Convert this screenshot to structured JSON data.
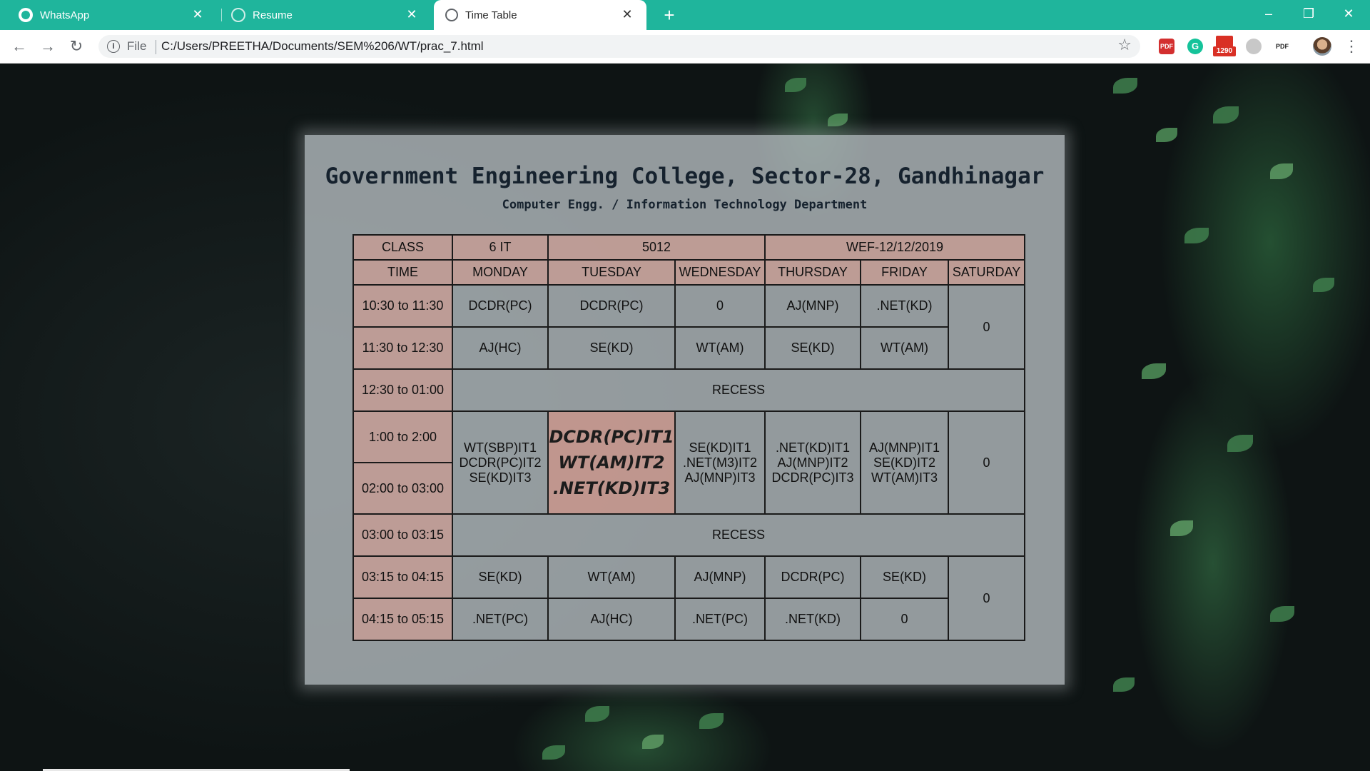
{
  "browser": {
    "tabs": [
      {
        "title": "WhatsApp",
        "icon": "whatsapp-icon"
      },
      {
        "title": "Resume",
        "icon": "globe-icon"
      },
      {
        "title": "Time Table",
        "icon": "globe-icon",
        "active": true
      }
    ],
    "address": {
      "scheme_label": "File",
      "url": "C:/Users/PREETHA/Documents/SEM%206/WT/prac_7.html"
    },
    "extensions": {
      "gmail_badge": "1290",
      "pdf_label": "PDF"
    }
  },
  "page": {
    "college": "Government Engineering College, Sector-28, Gandhinagar",
    "department": "Computer Engg. / Information Technology Department",
    "header_row": {
      "class_label": "CLASS",
      "class_value": "6 IT",
      "room": "5012",
      "wef": "WEF-12/12/2019"
    },
    "days_row": {
      "time_label": "TIME",
      "days": [
        "MONDAY",
        "TUESDAY",
        "WEDNESDAY",
        "THURSDAY",
        "FRIDAY",
        "SATURDAY"
      ]
    },
    "rows": {
      "r1": {
        "time": "10:30 to 11:30",
        "cells": [
          "DCDR(PC)",
          "DCDR(PC)",
          "0",
          "AJ(MNP)",
          ".NET(KD)"
        ]
      },
      "r2": {
        "time": "11:30 to 12:30",
        "cells": [
          "AJ(HC)",
          "SE(KD)",
          "WT(AM)",
          "SE(KD)",
          "WT(AM)"
        ]
      },
      "sat_morning": "0",
      "recess1": {
        "time": "12:30 to 01:00",
        "label": "RECESS"
      },
      "lab": {
        "time1": "1:00 to 2:00",
        "time2": "02:00 to 03:00",
        "mon": [
          "WT(SBP)IT1",
          "DCDR(PC)IT2",
          "SE(KD)IT3"
        ],
        "tue": [
          "DCDR(PC)IT1",
          "WT(AM)IT2",
          ".NET(KD)IT3"
        ],
        "wed": [
          "SE(KD)IT1",
          ".NET(M3)IT2",
          "AJ(MNP)IT3"
        ],
        "thu": [
          ".NET(KD)IT1",
          "AJ(MNP)IT2",
          "DCDR(PC)IT3"
        ],
        "fri": [
          "AJ(MNP)IT1",
          "SE(KD)IT2",
          "WT(AM)IT3"
        ],
        "sat": "0"
      },
      "recess2": {
        "time": "03:00 to 03:15",
        "label": "RECESS"
      },
      "r5": {
        "time": "03:15 to 04:15",
        "cells": [
          "SE(KD)",
          "WT(AM)",
          "AJ(MNP)",
          "DCDR(PC)",
          "SE(KD)"
        ]
      },
      "r6": {
        "time": "04:15 to 05:15",
        "cells": [
          ".NET(PC)",
          "AJ(HC)",
          ".NET(PC)",
          ".NET(KD)",
          "0"
        ]
      },
      "sat_evening": "0"
    }
  }
}
